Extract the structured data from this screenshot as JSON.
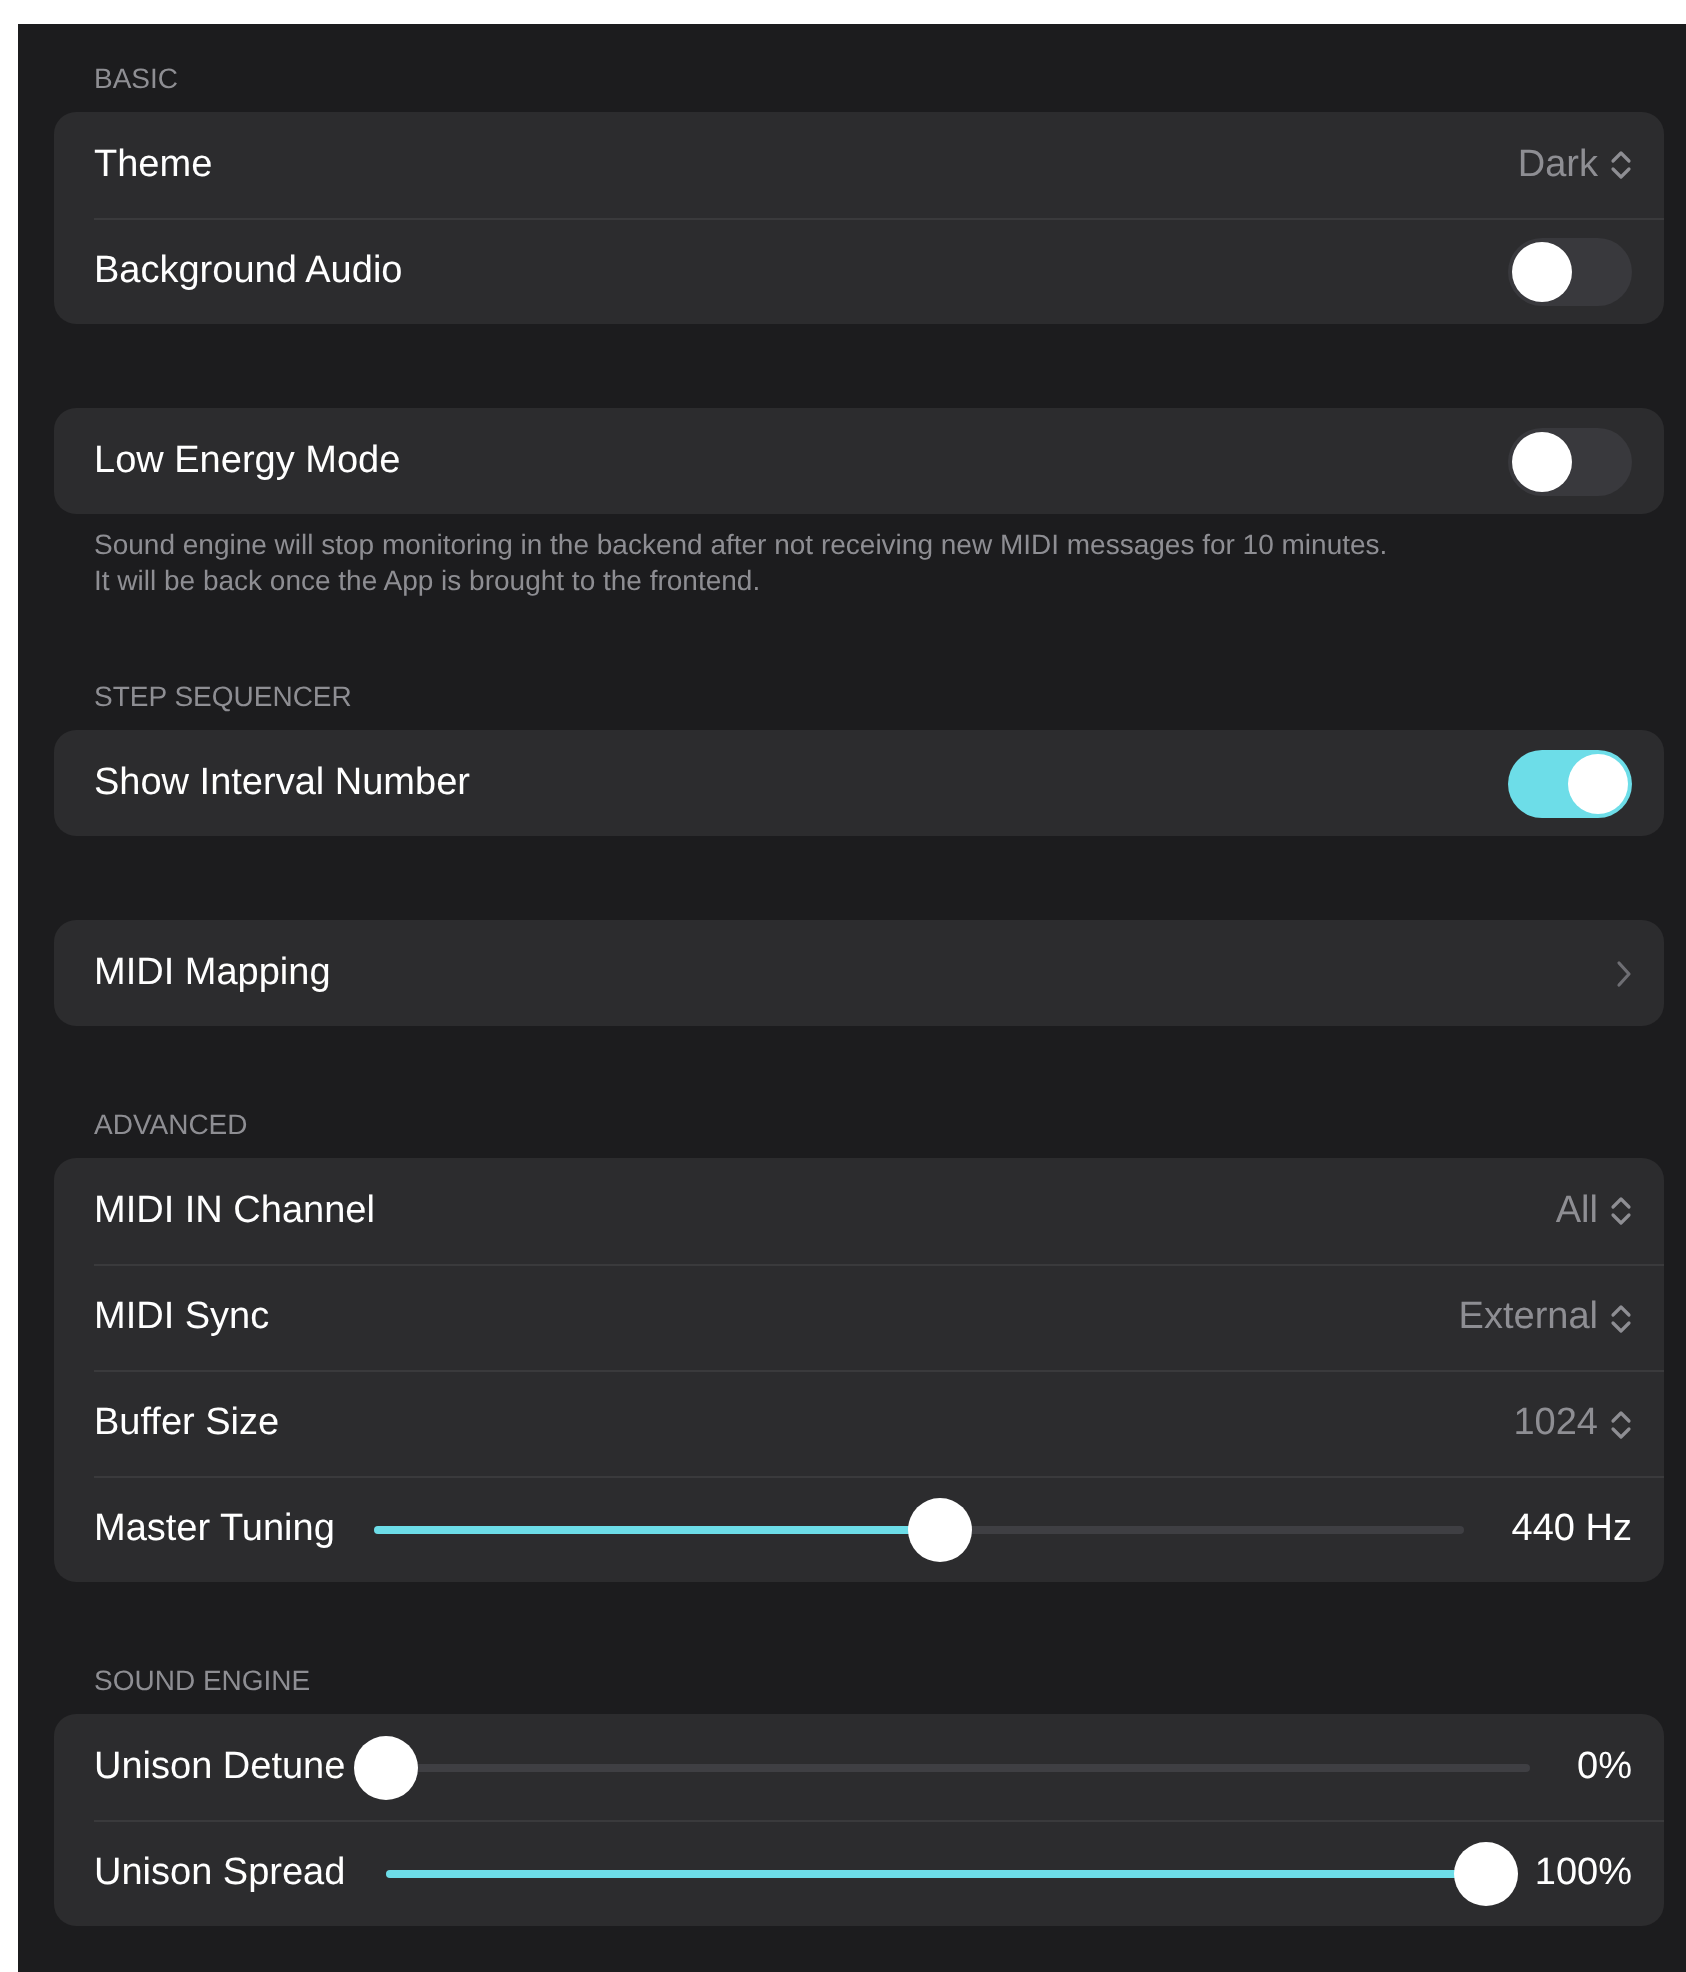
{
  "sections": [
    {
      "header": "BASIC",
      "rows": [
        {
          "kind": "picker",
          "label": "Theme",
          "value": "Dark"
        },
        {
          "kind": "toggle",
          "label": "Background Audio",
          "on": false
        }
      ]
    },
    {
      "rows": [
        {
          "kind": "toggle",
          "label": "Low Energy Mode",
          "on": false
        }
      ],
      "footer": "Sound engine will stop monitoring in the backend after not receiving new MIDI messages for 10 minutes.\nIt will be back once the App is brought to the frontend."
    },
    {
      "header": "STEP SEQUENCER",
      "rows": [
        {
          "kind": "toggle",
          "label": "Show Interval Number",
          "on": true
        }
      ]
    },
    {
      "rows": [
        {
          "kind": "link",
          "label": "MIDI Mapping"
        }
      ]
    },
    {
      "header": "ADVANCED",
      "rows": [
        {
          "kind": "picker",
          "label": "MIDI IN Channel",
          "value": "All"
        },
        {
          "kind": "picker",
          "label": "MIDI Sync",
          "value": "External"
        },
        {
          "kind": "picker",
          "label": "Buffer Size",
          "value": "1024"
        },
        {
          "kind": "slider",
          "label": "Master Tuning",
          "level": 0.52,
          "reading": "440 Hz"
        }
      ]
    },
    {
      "header": "SOUND ENGINE",
      "rows": [
        {
          "kind": "slider",
          "label": "Unison Detune",
          "level": 0,
          "reading": "0%"
        },
        {
          "kind": "slider",
          "label": "Unison Spread",
          "level": 1,
          "reading": "100%"
        }
      ]
    }
  ]
}
